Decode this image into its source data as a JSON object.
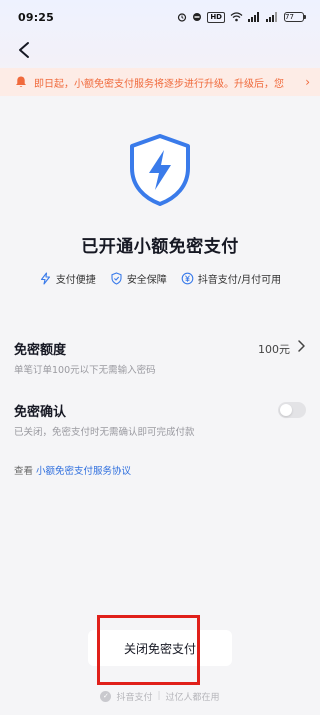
{
  "status_bar": {
    "time": "09:25",
    "hd_label": "HD",
    "battery": "77"
  },
  "notice": {
    "text": "即日起，小额免密支付服务将逐步进行升级。升级后，您",
    "color": "#f06a3c"
  },
  "main": {
    "title": "已开通小额免密支付",
    "accent_color": "#3a7bea",
    "features": [
      {
        "icon": "lightning-icon",
        "label": "支付便捷"
      },
      {
        "icon": "shield-check-icon",
        "label": "安全保障"
      },
      {
        "icon": "yuan-icon",
        "label": "抖音支付/月付可用"
      }
    ]
  },
  "limit": {
    "label": "免密额度",
    "value": "100元",
    "description": "单笔订单100元以下无需输入密码"
  },
  "confirm": {
    "label": "免密确认",
    "enabled": false,
    "description": "已关闭，免密支付时无需确认即可完成付款"
  },
  "agreement": {
    "prefix": "查看",
    "link": "小额免密支付服务协议"
  },
  "close_button": {
    "label": "关闭免密支付"
  },
  "footer": {
    "brand": "抖音支付",
    "separator": "|",
    "tagline": "过亿人都在用"
  }
}
